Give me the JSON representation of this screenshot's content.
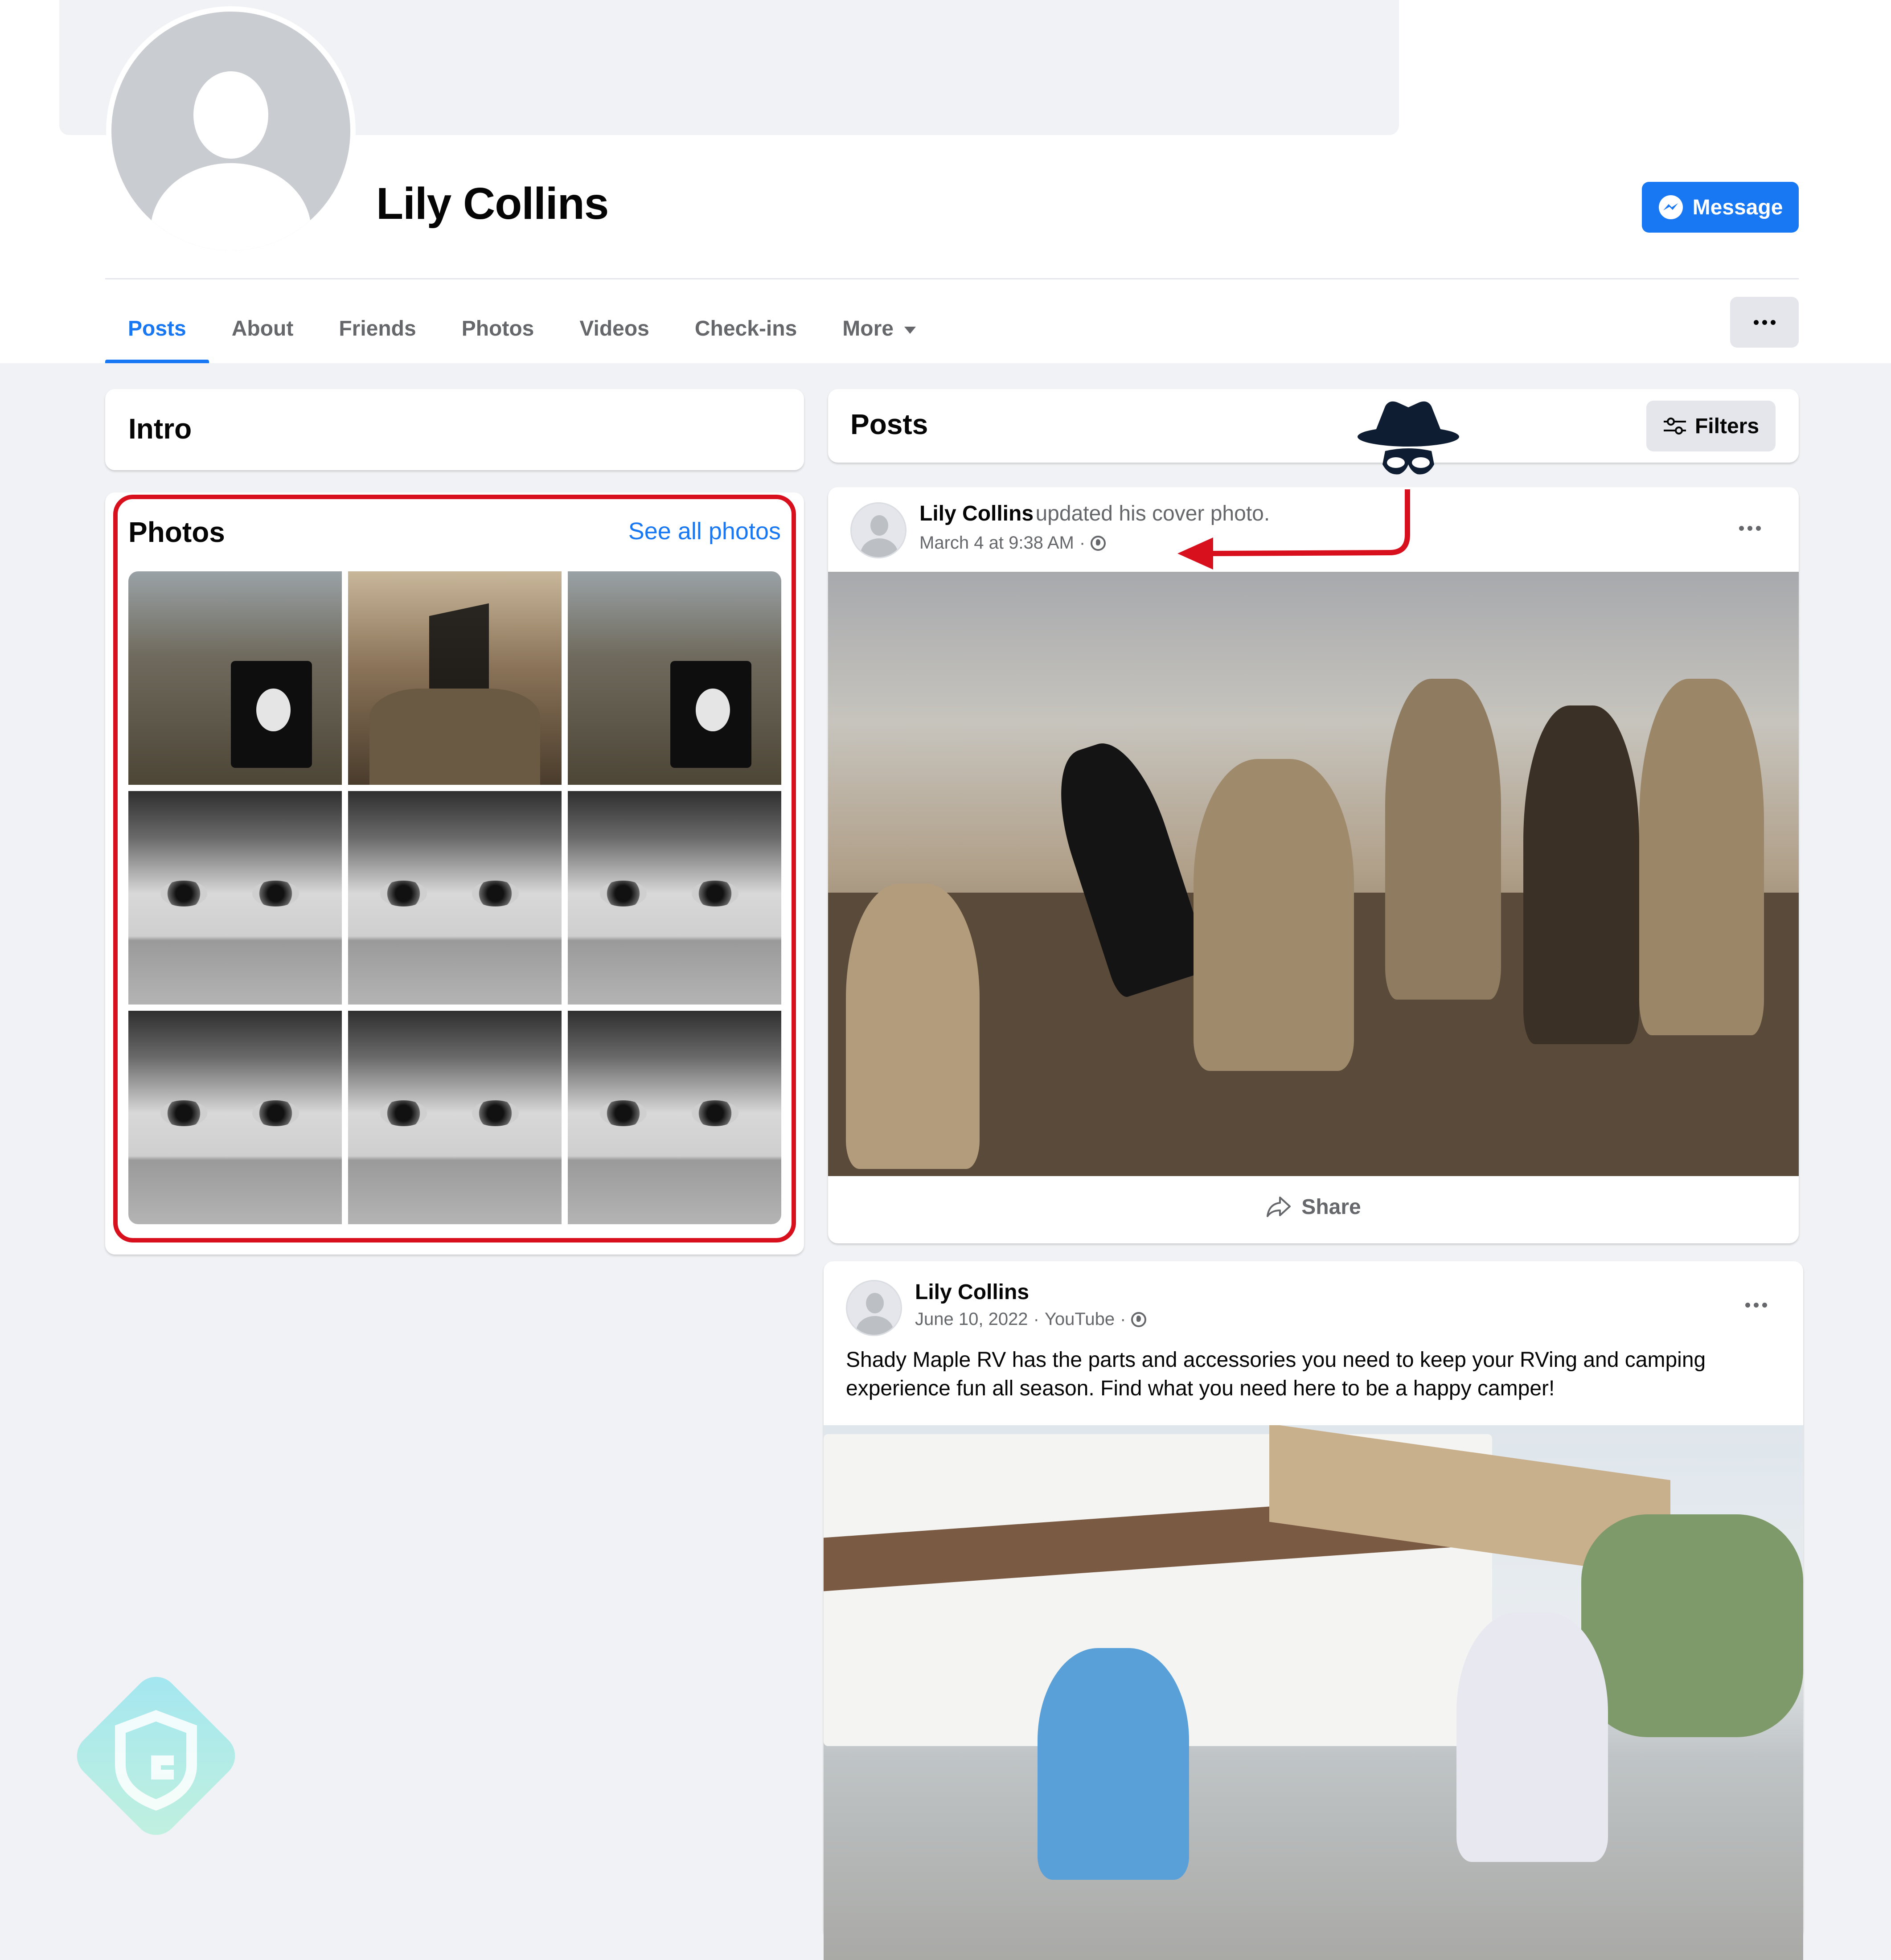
{
  "profile": {
    "name": "Lily Collins",
    "message_label": "Message"
  },
  "tabs": [
    {
      "label": "Posts",
      "active": true
    },
    {
      "label": "About",
      "active": false
    },
    {
      "label": "Friends",
      "active": false
    },
    {
      "label": "Photos",
      "active": false
    },
    {
      "label": "Videos",
      "active": false
    },
    {
      "label": "Check-ins",
      "active": false
    },
    {
      "label": "More",
      "active": false
    }
  ],
  "intro": {
    "title": "Intro"
  },
  "photos": {
    "title": "Photos",
    "see_all_label": "See all photos",
    "grid": [
      "crowd-with-flag",
      "desert-fighters",
      "crowd-with-flag",
      "woman-eyes",
      "woman-eyes",
      "woman-eyes",
      "woman-eyes",
      "woman-eyes",
      "woman-eyes"
    ]
  },
  "posts_section": {
    "title": "Posts",
    "filters_label": "Filters"
  },
  "posts": [
    {
      "author": "Lily Collins",
      "action": "updated his cover photo.",
      "date": "March 4 at 9:38 AM",
      "separator": "·",
      "image": "masked-fighters-with-flag",
      "share_label": "Share"
    },
    {
      "author": "Lily Collins",
      "date": "June 10, 2022",
      "separator": "·",
      "source": "YouTube",
      "text": "Shady Maple RV has the parts and accessories you need to keep your RVing and camping experience fun all season. Find what you need here to be a happy camper!",
      "image": "couple-camping-by-rv"
    }
  ],
  "annotations": {
    "highlight_color": "#d8101e",
    "arrow_color": "#d8101e",
    "spy_icon": "incognito-spy-icon"
  },
  "colors": {
    "accent": "#1877f2",
    "background": "#f0f2f5",
    "secondary_text": "#65676b"
  }
}
